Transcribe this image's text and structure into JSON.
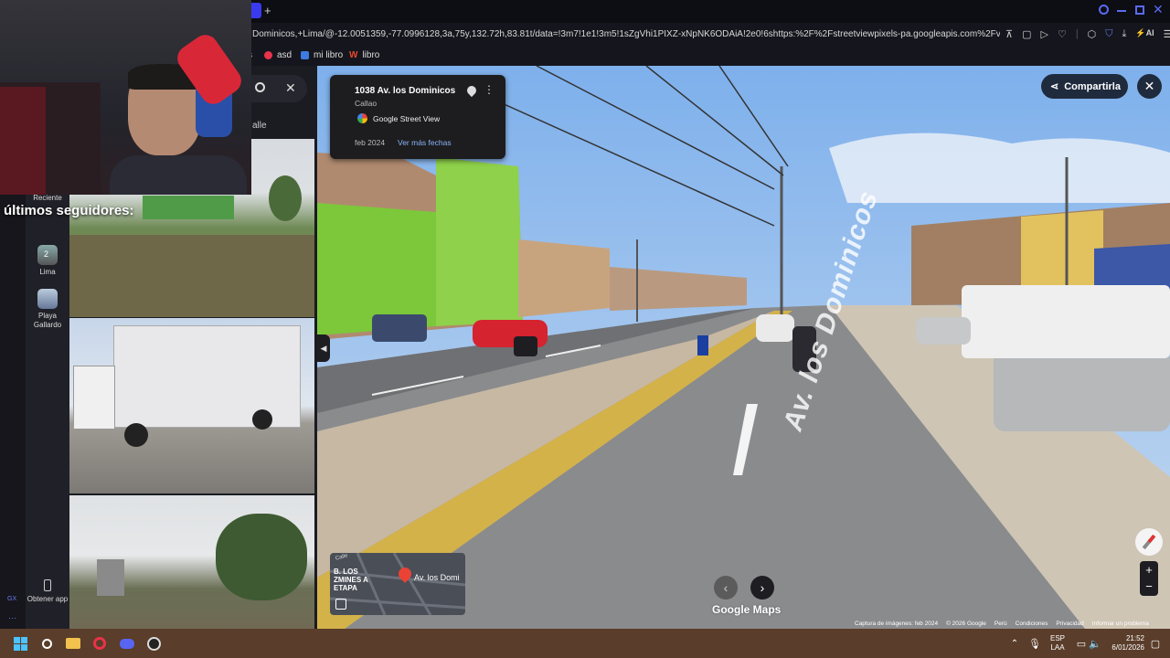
{
  "browser": {
    "url": "Dominicos,+Lima/@-12.0051359,-77.0996128,3a,75y,132.72h,83.81t/data=!3m7!1e1!3m5!1sZgVhi1PIXZ-xNpNK6ODAiA!2e0!6shttps:%2F%2Fstreetviewpixels-pa.googleapis.com%2Fv1%2Fthumbnail%",
    "ai_label": "AI",
    "bookmarks": [
      {
        "label": "s",
        "color": "#9aa"
      },
      {
        "label": "asd",
        "color": "#e8334a"
      },
      {
        "label": "mi libro",
        "color": "#3d7be0"
      },
      {
        "label": "libro",
        "color": "#e84a2a"
      }
    ]
  },
  "overlay": {
    "followers_title": "últimos seguidores:"
  },
  "sidebar": {
    "recent_label": "Reciente",
    "items": [
      {
        "label": "Lima",
        "badge": "2"
      },
      {
        "label": "Playa Gallardo"
      }
    ],
    "get_app": "Obtener app"
  },
  "results": {
    "partial_label": "alle"
  },
  "place_card": {
    "title": "1038 Av. los Dominicos",
    "subtitle": "Callao",
    "source": "Google Street View",
    "date": "feb 2024",
    "more_dates": "Ver más fechas"
  },
  "streetview": {
    "street_label": "Av. los Dominicos",
    "share_label": "Compartirla",
    "watermark": "Google Maps"
  },
  "minimap": {
    "place_label": "Av. los Domi",
    "area_label": "B. LOS ZMINES A ETAPA",
    "street_label": "Calle"
  },
  "footer": {
    "items": [
      "Captura de imágenes: feb 2024",
      "© 2026 Google",
      "Perú",
      "Condiciones",
      "Privacidad",
      "Informar un problema"
    ]
  },
  "taskbar": {
    "lang_top": "ESP",
    "lang_bottom": "LAA",
    "time": "21:52",
    "date": "6/01/2026"
  },
  "colors": {
    "accent_green": "#8fd14a",
    "sky": "#9cc4f0",
    "taskbar": "#5a3d2a"
  }
}
